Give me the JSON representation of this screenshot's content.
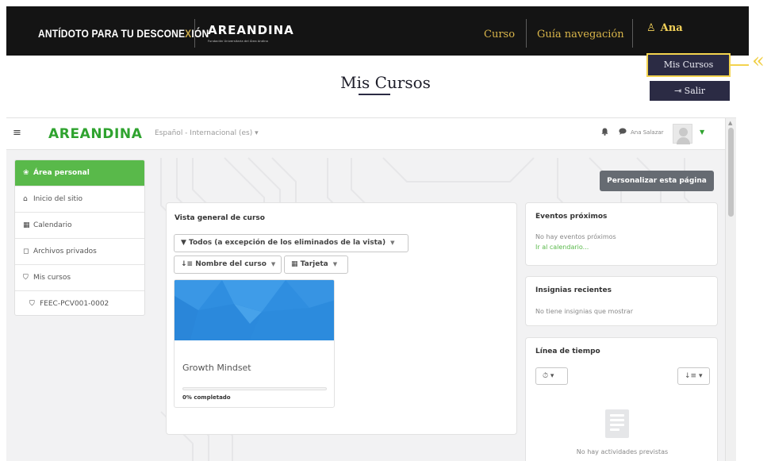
{
  "header": {
    "tagline_pre": "ANTÍDOTO PARA TU DESCONE",
    "tagline_x": "X",
    "tagline_post": "IÓN",
    "logo": "AREANDINA",
    "logo_sub": "Fundación Universitaria del Área Andina",
    "nav": {
      "curso": "Curso",
      "guia": "Guía navegación",
      "user": "Ana"
    },
    "user_icon": "user-icon",
    "accent_color": "#f3d34e"
  },
  "dropdown": {
    "mis_cursos": "Mis Cursos",
    "salir_icon": "⇥",
    "salir": "Salir",
    "pointer": "«"
  },
  "page": {
    "title": "Mis Cursos"
  },
  "moodle": {
    "hamburger_icon": "≡",
    "logo": "AREANDINA",
    "language": "Español - Internacional (es)",
    "lang_caret": "▾",
    "bell_icon": "bell-icon",
    "chat_icon": "chat-icon",
    "username": "Ana Salazar",
    "sidebar": {
      "items": [
        {
          "icon": "❀",
          "label": "Área personal"
        },
        {
          "icon": "⌂",
          "label": "Inicio del sitio"
        },
        {
          "icon": "▦",
          "label": "Calendario"
        },
        {
          "icon": "◻",
          "label": "Archivos privados"
        },
        {
          "icon": "⛉",
          "label": "Mis cursos"
        },
        {
          "icon": "⛉",
          "label": "FEEC-PCV001-0002"
        }
      ]
    },
    "personalize_button": "Personalizar esta página",
    "overview": {
      "title": "Vista general de curso",
      "filter": "▼ Todos (a excepción de los eliminados de la vista)",
      "sort": "↓≡ Nombre del curso",
      "view": "▦ Tarjeta",
      "course": {
        "name": "Growth Mindset",
        "progress_text": "0% completado",
        "progress": 0
      }
    },
    "events": {
      "title": "Eventos próximos",
      "empty": "No hay eventos próximos",
      "link": "Ir al calendario..."
    },
    "badges": {
      "title": "Insignias recientes",
      "empty": "No tiene insignias que mostrar"
    },
    "timeline": {
      "title": "Línea de tiempo",
      "filter_icon": "⏱",
      "sort_icon": "↓≡",
      "empty": "No hay actividades previstas"
    }
  }
}
